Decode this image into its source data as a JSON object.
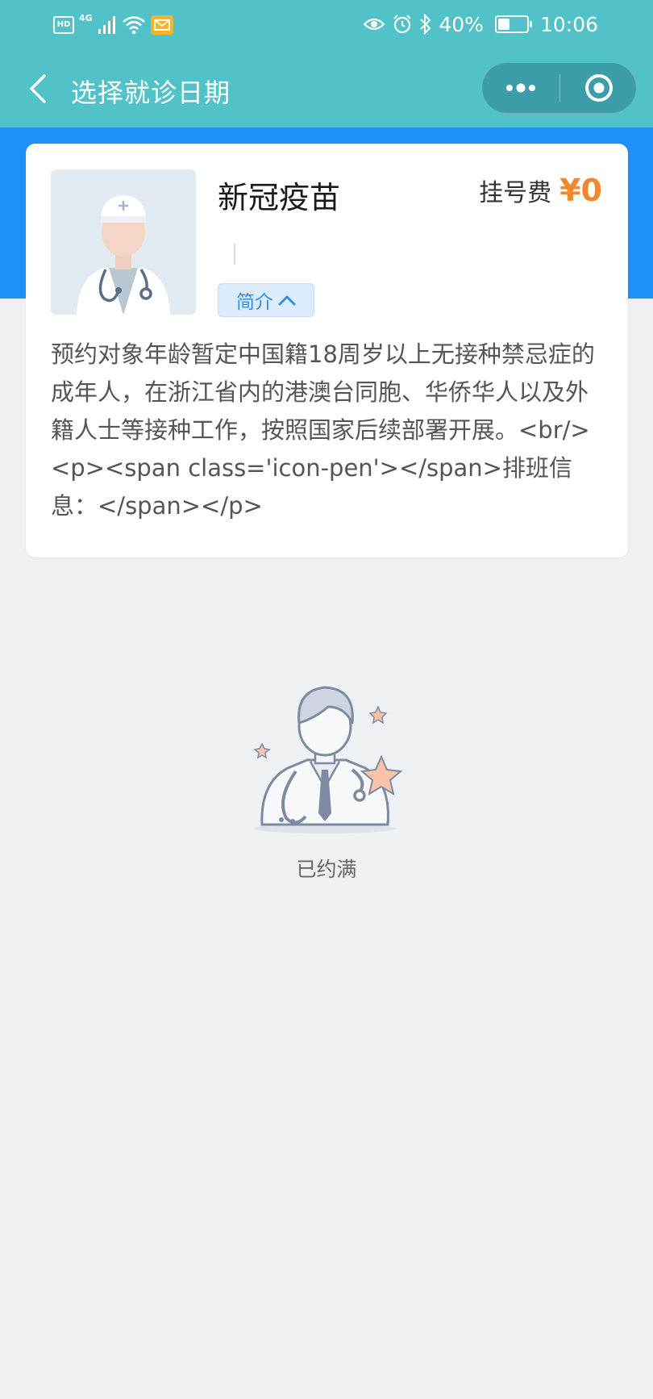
{
  "status_bar": {
    "hd": "HD",
    "network": "4G",
    "battery_percent": "40%",
    "battery_level": 0.4,
    "time": "10:06"
  },
  "nav": {
    "title": "选择就诊日期"
  },
  "card": {
    "name": "新冠疫苗",
    "fee_label": "挂号费",
    "fee_value": "¥0",
    "intro_label": "简介",
    "description": "预约对象年龄暂定中国籍18周岁以上无接种禁忌症的成年人，在浙江省内的港澳台同胞、华侨华人以及外籍人士等接种工作，按照国家后续部署开展。<br/><p><span class='icon-pen'></span>排班信息：</span></p>"
  },
  "empty_state": {
    "text": "已约满"
  },
  "colors": {
    "header": "#52c2c9",
    "band": "#1e90f7",
    "fee": "#f0882e",
    "tag_text": "#2f8fe0"
  },
  "icons": {
    "back": "chevron-left-icon",
    "more": "more-dots-icon",
    "close": "target-circle-icon",
    "intro_toggle": "chevron-up-icon"
  }
}
